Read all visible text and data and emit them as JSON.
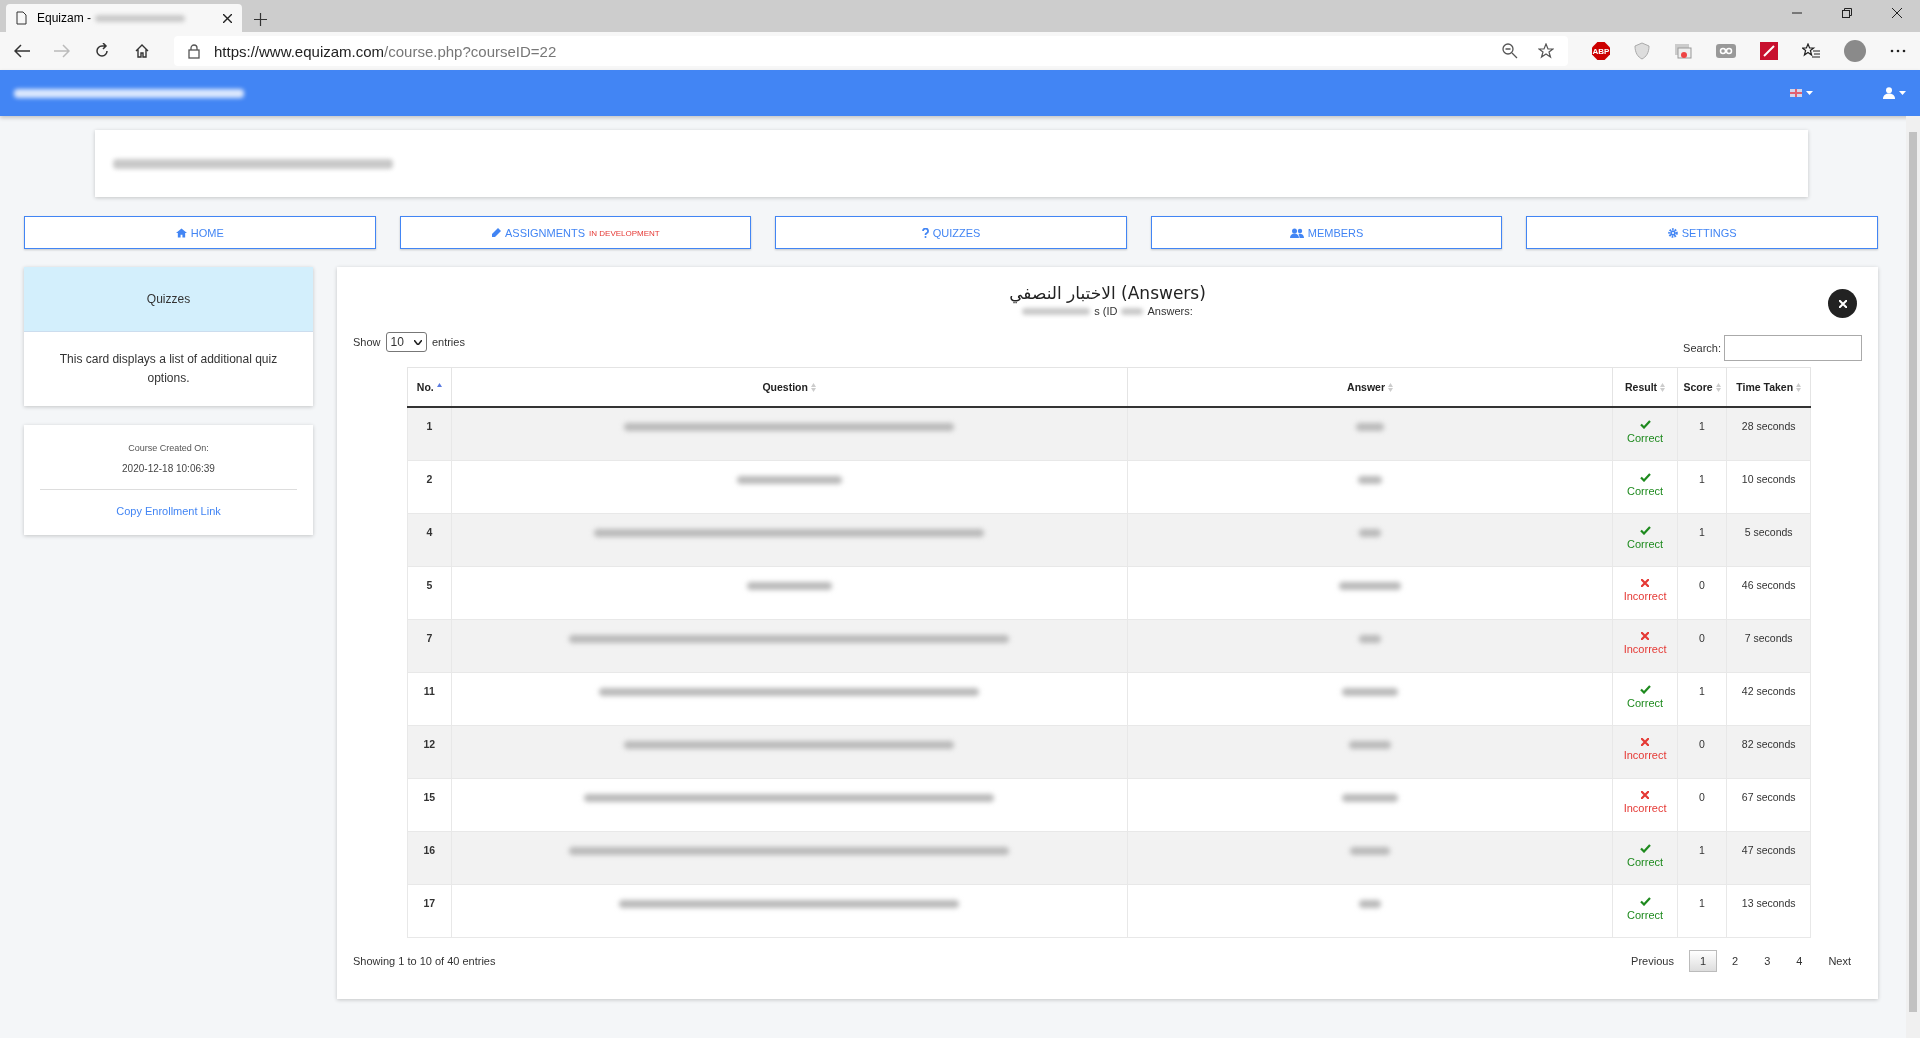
{
  "browser": {
    "tab_title": "Equizam -",
    "url_host": "https://www.equizam.com",
    "url_path": "/course.php?courseID=22",
    "extension_label": "ABP"
  },
  "nav": [
    {
      "label": "HOME"
    },
    {
      "label": "ASSIGNMENTS",
      "badge": "IN DEVELOPMENT"
    },
    {
      "label": "QUIZZES"
    },
    {
      "label": "MEMBERS"
    },
    {
      "label": "SETTINGS"
    }
  ],
  "sidebar": {
    "quizzes_title": "Quizzes",
    "quizzes_text": "This card displays a list of additional quiz options.",
    "created_label": "Course Created On:",
    "created_value": "2020-12-18 10:06:39",
    "link": "Copy Enrollment Link"
  },
  "main": {
    "title": "الاختبار النصفي (Answers)",
    "subtitle_id": "s (ID",
    "subtitle_tail": "Answers:",
    "show_label": "Show",
    "page_size": "10",
    "entries_label": "entries",
    "search_label": "Search:",
    "columns": [
      {
        "label": "No.",
        "sorted": true
      },
      {
        "label": "Question",
        "sorted": false
      },
      {
        "label": "Answer",
        "sorted": false
      },
      {
        "label": "Result",
        "sorted": false
      },
      {
        "label": "Score",
        "sorted": false
      },
      {
        "label": "Time Taken",
        "sorted": false
      }
    ],
    "rows": [
      {
        "no": "1",
        "result": "Correct",
        "correct": true,
        "score": "1",
        "time": "28 seconds"
      },
      {
        "no": "2",
        "result": "Correct",
        "correct": true,
        "score": "1",
        "time": "10 seconds"
      },
      {
        "no": "4",
        "result": "Correct",
        "correct": true,
        "score": "1",
        "time": "5 seconds"
      },
      {
        "no": "5",
        "result": "Incorrect",
        "correct": false,
        "score": "0",
        "time": "46 seconds"
      },
      {
        "no": "7",
        "result": "Incorrect",
        "correct": false,
        "score": "0",
        "time": "7 seconds"
      },
      {
        "no": "11",
        "result": "Correct",
        "correct": true,
        "score": "1",
        "time": "42 seconds"
      },
      {
        "no": "12",
        "result": "Incorrect",
        "correct": false,
        "score": "0",
        "time": "82 seconds"
      },
      {
        "no": "15",
        "result": "Incorrect",
        "correct": false,
        "score": "0",
        "time": "67 seconds"
      },
      {
        "no": "16",
        "result": "Correct",
        "correct": true,
        "score": "1",
        "time": "47 seconds"
      },
      {
        "no": "17",
        "result": "Correct",
        "correct": true,
        "score": "1",
        "time": "13 seconds"
      }
    ],
    "info": "Showing 1 to 10 of 40 entries",
    "pages": [
      {
        "label": "Previous",
        "selected": false
      },
      {
        "label": "1",
        "selected": true
      },
      {
        "label": "2",
        "selected": false
      },
      {
        "label": "3",
        "selected": false
      },
      {
        "label": "4",
        "selected": false
      },
      {
        "label": "Next",
        "selected": false
      }
    ]
  }
}
